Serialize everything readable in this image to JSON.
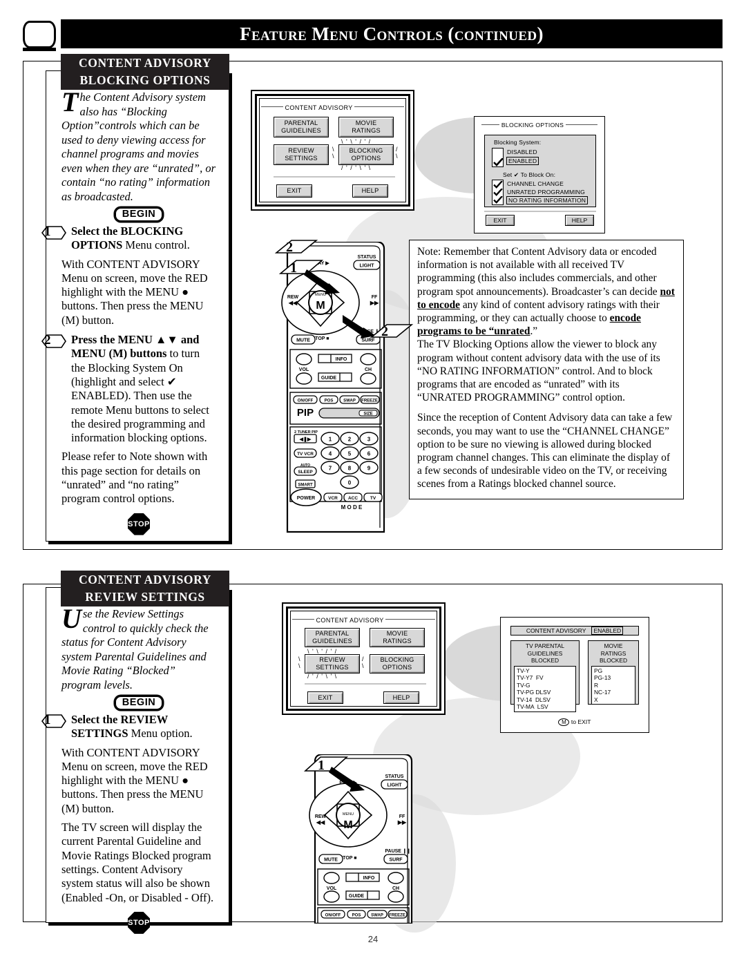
{
  "header": {
    "title": "Feature Menu Controls (continued)",
    "tv_icon": "tv-icon"
  },
  "page_number": "24",
  "section_top": {
    "title_line1": "CONTENT ADVISORY",
    "title_line2": "BLOCKING OPTIONS",
    "intro_dropcap": "T",
    "intro_text": "he Content Advisory system also has “Blocking Option”controls which can be used to deny viewing access for channel programs and movies even when they are “unrated”, or contain “no rating” information as broadcasted.",
    "begin_label": "BEGIN",
    "stop_label": "STOP",
    "steps": [
      {
        "number": "1",
        "heading_bold": "Select the BLOCKING OPTIONS",
        "heading_rest": " Menu control.",
        "paragraphs": [
          "With CONTENT ADVISORY Menu on screen, move the RED highlight with the MENU ● buttons. Then press the MENU (M) button."
        ]
      },
      {
        "number": "2",
        "heading_bold": "Press the MENU ▲▼ and MENU (M) buttons",
        "heading_rest": " to turn the Blocking System On (highlight and select ✔ ENABLED). Then use the remote Menu buttons to select the desired programming and information blocking options.",
        "paragraphs": [
          "Please refer to Note shown with this page section for details on “unrated” and “no rating” program control options."
        ]
      }
    ],
    "note": {
      "p1_a": "Note: Remember that Content Advisory data or encoded information is not available with all received TV programming (this also includes commercials, and other program spot announcements). Broadcaster’s can decide ",
      "p1_b": "not to encode",
      "p1_c": " any kind of content advisory ratings with their programming, or they can actually choose to ",
      "p1_d": "encode programs to be “unrated",
      "p1_e": ".”",
      "p2": "The TV Blocking Options allow the viewer to block any program without content advisory data with the use of its “NO RATING INFORMATION” control. And to block programs that are encoded as “unrated” with its “UNRATED PROGRAMMING” control option.",
      "p3": "Since the reception of Content Advisory data can take a few seconds, you may want to use the “CHANNEL CHANGE” option to be sure no viewing is allowed during blocked program channel changes. This can eliminate the display of a few seconds of undesirable video on the TV, or receiving scenes from a Ratings blocked channel source."
    },
    "tv_menu": {
      "legend": "CONTENT ADVISORY",
      "buttons": [
        {
          "line1": "PARENTAL",
          "line2": "GUIDELINES"
        },
        {
          "line1": "MOVIE",
          "line2": "RATINGS"
        },
        {
          "line1": "REVIEW",
          "line2": "SETTINGS"
        },
        {
          "line1": "BLOCKING",
          "line2": "OPTIONS"
        }
      ],
      "highlighted": "BLOCKING OPTIONS",
      "exit": "EXIT",
      "help": "HELP"
    },
    "osd_blocking": {
      "title": "BLOCKING OPTIONS",
      "system_label": "Blocking System:",
      "system_options": [
        {
          "label": "DISABLED",
          "checked": false,
          "selected": false
        },
        {
          "label": "ENABLED",
          "checked": true,
          "selected": true
        }
      ],
      "block_label": "Set ✔ To Block On:",
      "block_options": [
        {
          "label": "CHANNEL CHANGE",
          "checked": true,
          "selected": false
        },
        {
          "label": "UNRATED PROGRAMMING",
          "checked": true,
          "selected": false
        },
        {
          "label": "NO RATING INFORMATION",
          "checked": true,
          "selected": true
        }
      ],
      "exit": "EXIT",
      "help": "HELP"
    },
    "callouts": [
      {
        "number": "1"
      },
      {
        "number": "2"
      },
      {
        "number": "2"
      }
    ]
  },
  "section_bottom": {
    "title_line1": "CONTENT ADVISORY",
    "title_line2": "REVIEW SETTINGS",
    "intro_dropcap": "U",
    "intro_text": "se the Review Settings control to quickly check the status for Content Advisory system Parental Guidelines and Movie Rating “Blocked” program levels.",
    "begin_label": "BEGIN",
    "stop_label": "STOP",
    "steps": [
      {
        "number": "1",
        "heading_bold": "Select the REVIEW SETTINGS",
        "heading_rest": " Menu option.",
        "paragraphs": [
          "With CONTENT ADVISORY Menu on screen, move the RED highlight with the MENU ● buttons. Then press the MENU (M) button.",
          "The TV screen will display the current Parental Guideline and Movie Ratings Blocked program settings. Content Advisory system status will also be shown (Enabled -On, or Disabled - Off)."
        ]
      }
    ],
    "tv_menu": {
      "legend": "CONTENT ADVISORY",
      "buttons": [
        {
          "line1": "PARENTAL",
          "line2": "GUIDELINES"
        },
        {
          "line1": "MOVIE",
          "line2": "RATINGS"
        },
        {
          "line1": "REVIEW",
          "line2": "SETTINGS"
        },
        {
          "line1": "BLOCKING",
          "line2": "OPTIONS"
        }
      ],
      "highlighted": "REVIEW SETTINGS",
      "exit": "EXIT",
      "help": "HELP"
    },
    "osd_review": {
      "header_label": "CONTENT ADVISORY",
      "header_status": "ENABLED",
      "col1_title": "TV PARENTAL\nGUIDELINES\nBLOCKED",
      "col1_items": [
        "TV-Y",
        "TV-Y7  FV",
        "TV-G",
        "TV-PG DLSV",
        "TV-14  DLSV",
        "TV-MA  LSV"
      ],
      "col2_title": "MOVIE\nRATINGS\nBLOCKED",
      "col2_items": [
        "PG",
        "PG-13",
        "R",
        "NC-17",
        "X"
      ],
      "exit_button": "M",
      "exit_text": "to EXIT"
    },
    "callouts": [
      {
        "number": "1"
      }
    ]
  },
  "remote": {
    "labels": {
      "play": "PLAY",
      "status": "STATUS",
      "light": "LIGHT",
      "rew": "REW",
      "ff": "FF",
      "menu": "MENU",
      "menu_m": "M",
      "mute": "MUTE",
      "stop": "STOP",
      "pause": "PAUSE",
      "surf": "SURF",
      "vol": "VOL",
      "ch": "CH",
      "info": "INFO",
      "guide": "GUIDE",
      "on_off": "ON/OFF",
      "pos": "POS",
      "swap": "SWAP",
      "freeze": "FREEZE",
      "pip": "PIP",
      "size": "SIZE",
      "tuner_pip": "2 TUNER PIP",
      "tv_vcr": "TV VCR",
      "auto": "AUTO",
      "sleep": "SLEEP",
      "smart": "SMART",
      "power": "POWER",
      "vcr": "VCR",
      "acc": "ACC",
      "tv": "TV",
      "mode": "M  O  D  E",
      "keypad": [
        "1",
        "2",
        "3",
        "4",
        "5",
        "6",
        "7",
        "8",
        "9",
        "0"
      ]
    }
  },
  "colors": {
    "ink": "#000000",
    "panel_gray": "#d8d8d8",
    "shadow_gray": "#d9d9d9",
    "title_bg": "#231f20"
  }
}
